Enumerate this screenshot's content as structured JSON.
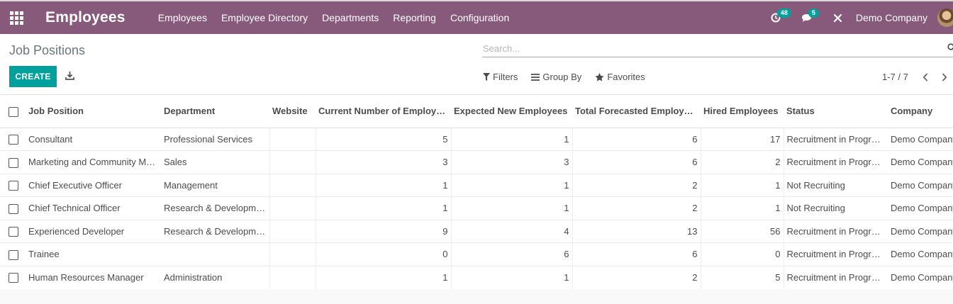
{
  "navbar": {
    "app_title": "Employees",
    "menu": [
      "Employees",
      "Employee Directory",
      "Departments",
      "Reporting",
      "Configuration"
    ],
    "activity_count": "48",
    "message_count": "5",
    "company": "Demo Company"
  },
  "control": {
    "title": "Job Positions",
    "search_placeholder": "Search...",
    "create_label": "CREATE",
    "filters_label": "Filters",
    "groupby_label": "Group By",
    "favorites_label": "Favorites",
    "pager_text": "1-7 / 7"
  },
  "table": {
    "columns": [
      "Job Position",
      "Department",
      "Website",
      "Current Number of Employees",
      "Expected New Employees",
      "Total Forecasted Employees",
      "Hired Employees",
      "Status",
      "Company"
    ],
    "rows": [
      [
        "Consultant",
        "Professional Services",
        "",
        "5",
        "1",
        "6",
        "17",
        "Recruitment in Progress",
        "Demo Company"
      ],
      [
        "Marketing and Community Manager",
        "Sales",
        "",
        "3",
        "3",
        "6",
        "2",
        "Recruitment in Progress",
        "Demo Company"
      ],
      [
        "Chief Executive Officer",
        "Management",
        "",
        "1",
        "1",
        "2",
        "1",
        "Not Recruiting",
        "Demo Company"
      ],
      [
        "Chief Technical Officer",
        "Research & Development",
        "",
        "1",
        "1",
        "2",
        "1",
        "Not Recruiting",
        "Demo Company"
      ],
      [
        "Experienced Developer",
        "Research & Development",
        "",
        "9",
        "4",
        "13",
        "56",
        "Recruitment in Progress",
        "Demo Company"
      ],
      [
        "Trainee",
        "",
        "",
        "0",
        "6",
        "6",
        "0",
        "Recruitment in Progress",
        "Demo Company"
      ],
      [
        "Human Resources Manager",
        "Administration",
        "",
        "1",
        "1",
        "2",
        "5",
        "Recruitment in Progress",
        "Demo Company"
      ]
    ]
  },
  "colors": {
    "navbar": "#875a7b",
    "primary": "#00a09d"
  },
  "icons": [
    "apps-grid-icon",
    "activity-clock-icon",
    "chat-bubble-icon",
    "tools-close-icon",
    "search-icon",
    "download-icon",
    "filter-icon",
    "list-bars-icon",
    "star-icon",
    "chevron-left-icon",
    "chevron-right-icon"
  ]
}
